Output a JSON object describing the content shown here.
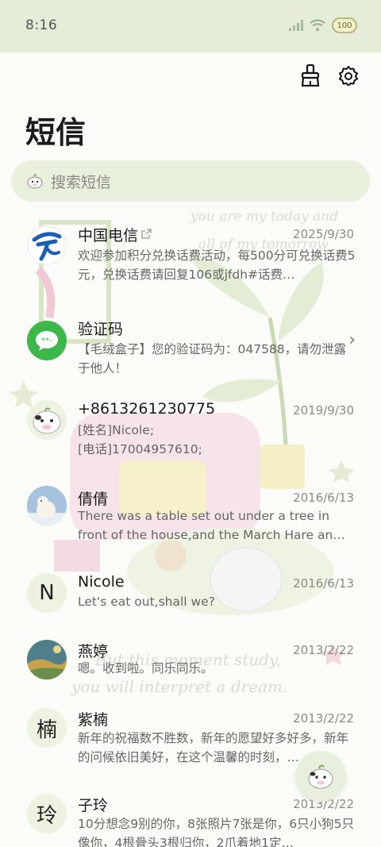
{
  "status_bar": {
    "time": "8:16",
    "battery": "100"
  },
  "header": {
    "title": "短信"
  },
  "search": {
    "placeholder": "搜索短信"
  },
  "conversations": [
    {
      "name": "中国电信",
      "date": "2025/9/30",
      "preview": "欢迎参加积分兑换话费活动，每500分可兑换话费5元，兑换话费请回复106或jfdh#话费…",
      "avatar": "china-telecom-logo",
      "external_link": true
    },
    {
      "name": "验证码",
      "date": "",
      "preview": "【毛绒盒子】您的验证码为：047588，请勿泄露于他人！",
      "avatar": "message-logo"
    },
    {
      "name": "+8613261230775",
      "date": "2019/9/30",
      "preview": "[姓名]Nicole;\n[电话]17004957610;",
      "avatar": "cow-avatar"
    },
    {
      "name": "倩倩",
      "date": "2016/6/13",
      "preview": "There was a table set out under a tree in front of the house,and the March Hare an…",
      "avatar": "polar-bear-photo"
    },
    {
      "name": "Nicole",
      "date": "2016/6/13",
      "preview": "Let's eat out,shall we?",
      "avatar_letter": "N"
    },
    {
      "name": "燕婷",
      "date": "2013/2/22",
      "preview": "嗯。收到啦。同乐同乐。",
      "avatar": "landscape-photo"
    },
    {
      "name": "紫楠",
      "date": "2013/2/22",
      "preview": "新年的祝福数不胜数，新年的愿望好多好多，新年的问候依旧美好，在这个温馨的时刻，…",
      "avatar_letter": "楠"
    },
    {
      "name": "子玲",
      "date": "2013/2/22",
      "preview": "10分想念9别的你，8张照片7张是你，6只小狗5只像你，4根骨头3根归你，2爪着地1定…",
      "avatar_letter": "玲"
    }
  ],
  "background_text": [
    "you are my today and",
    "all of my tomorrow",
    "But this moment study,",
    "you will interpret a dream."
  ],
  "colors": {
    "accent": "#e5ecd8",
    "search_bg": "#e9f0dc",
    "telecom_blue": "#1a5fb4",
    "message_green": "#3cb84a"
  }
}
